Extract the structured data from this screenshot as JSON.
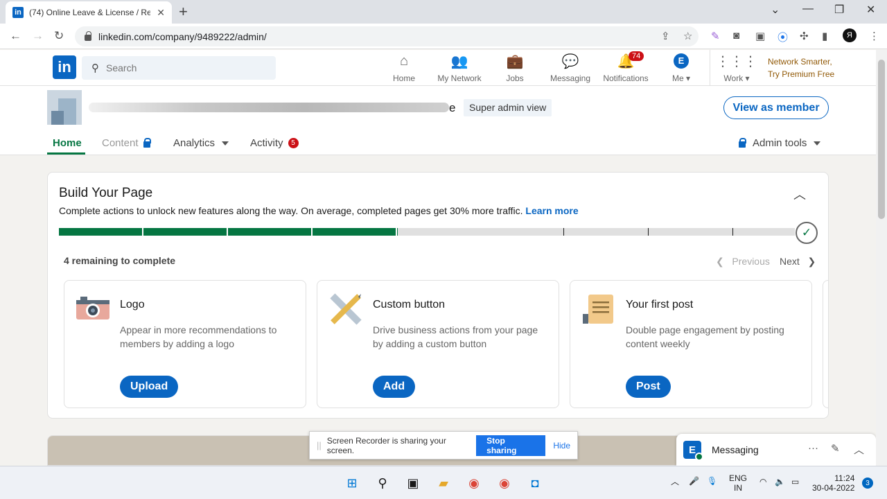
{
  "browser": {
    "tab_title": "(74) Online Leave & License / Re",
    "url": "linkedin.com/company/9489222/admin/"
  },
  "linkedin": {
    "logo": "in",
    "search_placeholder": "Search",
    "nav": [
      {
        "label": "Home",
        "icon": "home-icon"
      },
      {
        "label": "My Network",
        "icon": "network-icon"
      },
      {
        "label": "Jobs",
        "icon": "briefcase-icon"
      },
      {
        "label": "Messaging",
        "icon": "chat-icon"
      },
      {
        "label": "Notifications",
        "icon": "bell-icon",
        "badge": "74"
      },
      {
        "label": "Me",
        "icon": "avatar-icon"
      },
      {
        "label": "Work",
        "icon": "grid-icon"
      }
    ],
    "premium_line1": "Network Smarter,",
    "premium_line2": "Try Premium Free"
  },
  "page": {
    "name_suffix": "e",
    "role_badge": "Super admin view",
    "view_as_member": "View as member",
    "tabs": [
      {
        "label": "Home"
      },
      {
        "label": "Content"
      },
      {
        "label": "Analytics"
      },
      {
        "label": "Activity",
        "badge": "5"
      }
    ],
    "admin_tools": "Admin tools"
  },
  "build": {
    "title": "Build Your Page",
    "subtitle": "Complete actions to unlock new features along the way. On average, completed pages get 30% more traffic.",
    "learn_more": "Learn more",
    "progress_fraction": 0.46,
    "remaining": "4 remaining to complete",
    "previous": "Previous",
    "next": "Next",
    "cards": [
      {
        "title": "Logo",
        "desc": "Appear in more recommendations to members by adding a logo",
        "button": "Upload",
        "icon": "camera-icon"
      },
      {
        "title": "Custom button",
        "desc": "Drive business actions from your page by adding a custom button",
        "button": "Add",
        "icon": "ruler-pencil-icon"
      },
      {
        "title": "Your first post",
        "desc": "Double page engagement by posting content weekly",
        "button": "Post",
        "icon": "document-icon"
      }
    ]
  },
  "share_banner": {
    "text": "Screen Recorder is sharing your screen.",
    "stop": "Stop sharing",
    "hide": "Hide"
  },
  "messaging": {
    "label": "Messaging"
  },
  "taskbar": {
    "lang1": "ENG",
    "lang2": "IN",
    "time": "11:24",
    "date": "30-04-2022",
    "notif_count": "3"
  }
}
